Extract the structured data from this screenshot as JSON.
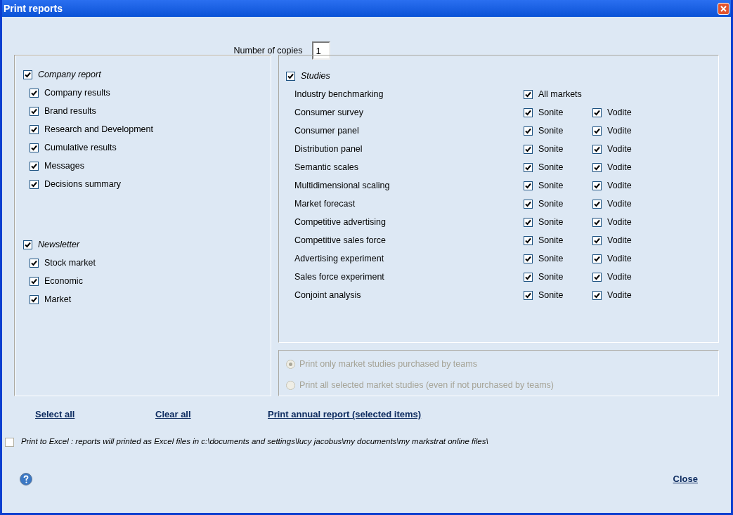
{
  "window": {
    "title": "Print reports"
  },
  "copies": {
    "label": "Number of copies",
    "value": "1"
  },
  "company_report": {
    "label": "Company report",
    "checked": true,
    "items": [
      {
        "label": "Company results",
        "checked": true
      },
      {
        "label": "Brand results",
        "checked": true
      },
      {
        "label": "Research and Development",
        "checked": true
      },
      {
        "label": "Cumulative results",
        "checked": true
      },
      {
        "label": "Messages",
        "checked": true
      },
      {
        "label": "Decisions summary",
        "checked": true
      }
    ]
  },
  "newsletter": {
    "label": "Newsletter",
    "checked": true,
    "items": [
      {
        "label": "Stock market",
        "checked": true
      },
      {
        "label": "Economic",
        "checked": true
      },
      {
        "label": "Market",
        "checked": true
      }
    ]
  },
  "studies": {
    "label": "Studies",
    "checked": true,
    "rows": [
      {
        "label": "Industry benchmarking",
        "markets": [
          {
            "label": "All markets",
            "checked": true
          }
        ]
      },
      {
        "label": "Consumer survey",
        "markets": [
          {
            "label": "Sonite",
            "checked": true
          },
          {
            "label": "Vodite",
            "checked": true
          }
        ]
      },
      {
        "label": "Consumer panel",
        "markets": [
          {
            "label": "Sonite",
            "checked": true
          },
          {
            "label": "Vodite",
            "checked": true
          }
        ]
      },
      {
        "label": "Distribution panel",
        "markets": [
          {
            "label": "Sonite",
            "checked": true
          },
          {
            "label": "Vodite",
            "checked": true
          }
        ]
      },
      {
        "label": "Semantic scales",
        "markets": [
          {
            "label": "Sonite",
            "checked": true
          },
          {
            "label": "Vodite",
            "checked": true
          }
        ]
      },
      {
        "label": "Multidimensional scaling",
        "markets": [
          {
            "label": "Sonite",
            "checked": true
          },
          {
            "label": "Vodite",
            "checked": true
          }
        ]
      },
      {
        "label": "Market forecast",
        "markets": [
          {
            "label": "Sonite",
            "checked": true
          },
          {
            "label": "Vodite",
            "checked": true
          }
        ]
      },
      {
        "label": "Competitive advertising",
        "markets": [
          {
            "label": "Sonite",
            "checked": true
          },
          {
            "label": "Vodite",
            "checked": true
          }
        ]
      },
      {
        "label": "Competitive sales force",
        "markets": [
          {
            "label": "Sonite",
            "checked": true
          },
          {
            "label": "Vodite",
            "checked": true
          }
        ]
      },
      {
        "label": "Advertising experiment",
        "markets": [
          {
            "label": "Sonite",
            "checked": true
          },
          {
            "label": "Vodite",
            "checked": true
          }
        ]
      },
      {
        "label": "Sales force experiment",
        "markets": [
          {
            "label": "Sonite",
            "checked": true
          },
          {
            "label": "Vodite",
            "checked": true
          }
        ]
      },
      {
        "label": "Conjoint analysis",
        "markets": [
          {
            "label": "Sonite",
            "checked": true
          },
          {
            "label": "Vodite",
            "checked": true
          }
        ]
      }
    ]
  },
  "study_scope": {
    "disabled": true,
    "options": [
      {
        "label": "Print only market studies purchased by teams",
        "selected": true
      },
      {
        "label": "Print all selected market studies (even if not purchased by teams)",
        "selected": false
      }
    ]
  },
  "links": [
    "Select all",
    "Clear all",
    "Print annual report (selected items)"
  ],
  "excel": {
    "label": "Print to Excel : reports will printed as Excel files in c:\\documents and settings\\lucy jacobus\\my documents\\my markstrat online files\\",
    "checked": false
  },
  "close": "Close"
}
